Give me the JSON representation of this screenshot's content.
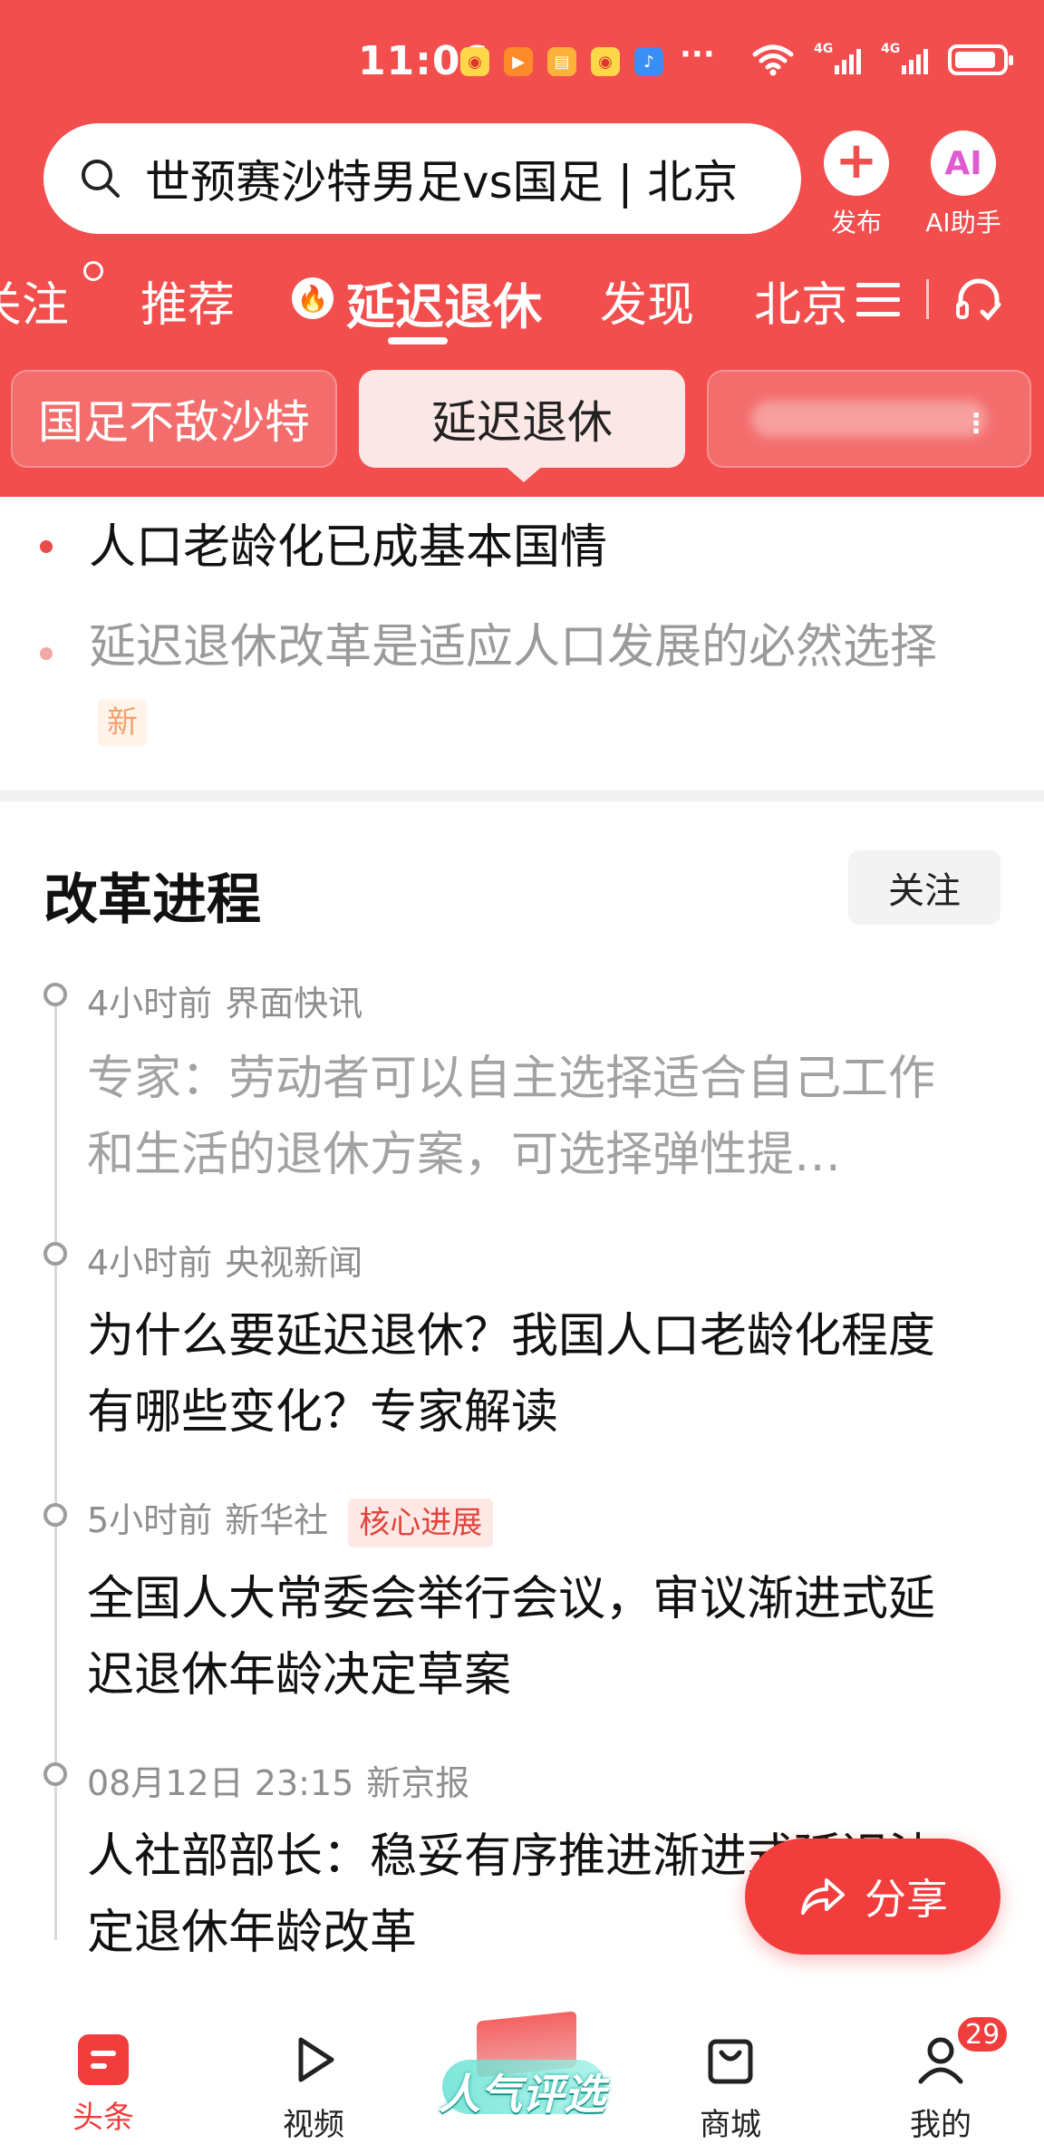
{
  "status_bar": {
    "time": "11:06",
    "more": "···",
    "network_1": "4G",
    "network_2": "4G"
  },
  "header": {
    "search_text": "世预赛沙特男足vs国足 | 北京",
    "publish_label": "发布",
    "ai_label": "AI助手",
    "ai_icon_text": "AI"
  },
  "tabs": [
    {
      "label": "关注"
    },
    {
      "label": "推荐"
    },
    {
      "label": "延迟退休"
    },
    {
      "label": "发现"
    },
    {
      "label": "北京"
    }
  ],
  "chips": [
    {
      "label": "国足不敌沙特"
    },
    {
      "label": "延迟退休"
    }
  ],
  "bullets": [
    {
      "text": "人口老龄化已成基本国情"
    },
    {
      "text": "延迟退休改革是适应人口发展的必然选择",
      "tag": "新"
    }
  ],
  "section": {
    "title": "改革进程",
    "follow_label": "关注"
  },
  "timeline": [
    {
      "time": "4小时前",
      "source": "界面快讯",
      "title": "专家：劳动者可以自主选择适合自己工作和生活的退休方案，可选择弹性提…"
    },
    {
      "time": "4小时前",
      "source": "央视新闻",
      "title": "为什么要延迟退休？我国人口老龄化程度有哪些变化？专家解读"
    },
    {
      "time": "5小时前",
      "source": "新华社",
      "tag": "核心进展",
      "title": "全国人大常委会举行会议，审议渐进式延迟退休年龄决定草案"
    },
    {
      "time": "08月12日 23:15",
      "source": "新京报",
      "title": "人社部部长：稳妥有序推进渐进式延迟法定退休年龄改革"
    }
  ],
  "share": {
    "label": "分享"
  },
  "bottom_nav": [
    {
      "label": "头条"
    },
    {
      "label": "视频"
    },
    {
      "label": "人气评选"
    },
    {
      "label": "商城"
    },
    {
      "label": "我的",
      "badge": "29"
    }
  ],
  "colors": {
    "brand_red": "#f24e4e",
    "fab_red": "#f23d3d",
    "core_tag": "#e2443e"
  }
}
